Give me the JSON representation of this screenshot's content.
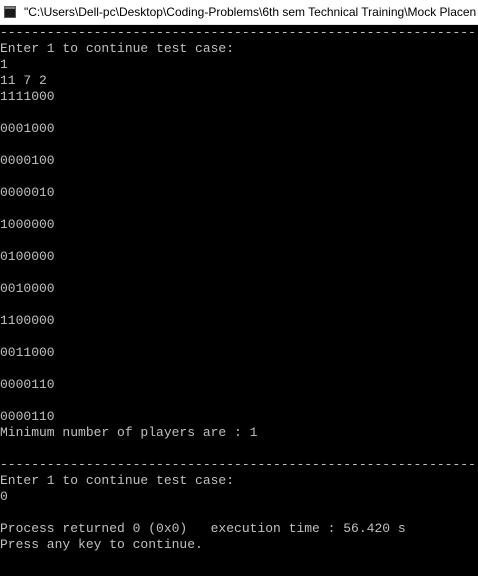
{
  "window": {
    "title": "\"C:\\Users\\Dell-pc\\Desktop\\Coding-Problems\\6th sem Technical Training\\Mock Placen",
    "icon": "console-window-icon"
  },
  "colors": {
    "background": "#000000",
    "text": "#c0c0c0",
    "titlebar": "#ffffff"
  },
  "console": {
    "lines": [
      "-----------------------------------------------------------------",
      "Enter 1 to continue test case:",
      "1",
      "11 7 2",
      "1111000",
      "",
      "0001000",
      "",
      "0000100",
      "",
      "0000010",
      "",
      "1000000",
      "",
      "0100000",
      "",
      "0010000",
      "",
      "1100000",
      "",
      "0011000",
      "",
      "0000110",
      "",
      "0000110",
      "Minimum number of players are : 1",
      "",
      "-----------------------------------------------------------------",
      "Enter 1 to continue test case:",
      "0",
      "",
      "Process returned 0 (0x0)   execution time : 56.420 s",
      "Press any key to continue."
    ]
  }
}
